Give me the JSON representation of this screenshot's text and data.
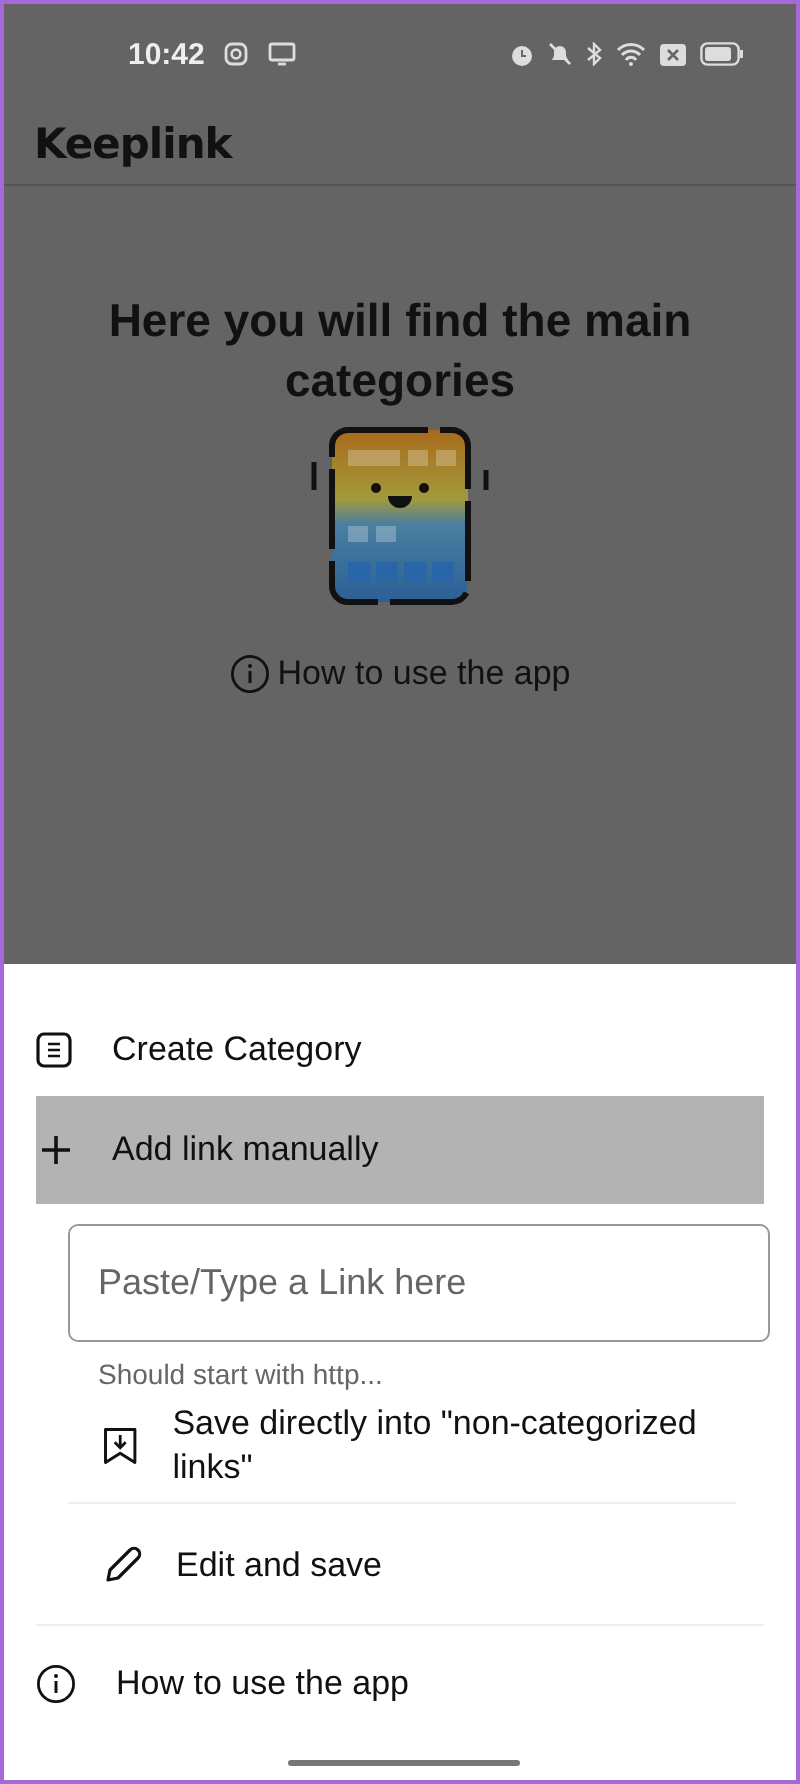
{
  "status_bar": {
    "time": "10:42"
  },
  "app_bar": {
    "title": "Keeplink"
  },
  "empty_state": {
    "heading": "Here you will find the main categories",
    "help_link": "How to use the app"
  },
  "sheet": {
    "items": [
      {
        "kind": "create",
        "label": "Create Category",
        "selected": false
      },
      {
        "kind": "add",
        "label": "Add link manually",
        "selected": true,
        "expanded": true,
        "field": {
          "placeholder": "Paste/Type a Link here",
          "hint": "Should start with http..."
        },
        "options": [
          {
            "kind": "save",
            "label": "Save directly into \"non-categorized links\""
          },
          {
            "kind": "edit",
            "label": "Edit and save"
          }
        ]
      },
      {
        "kind": "help",
        "label": "How to use the app",
        "selected": false
      }
    ]
  }
}
